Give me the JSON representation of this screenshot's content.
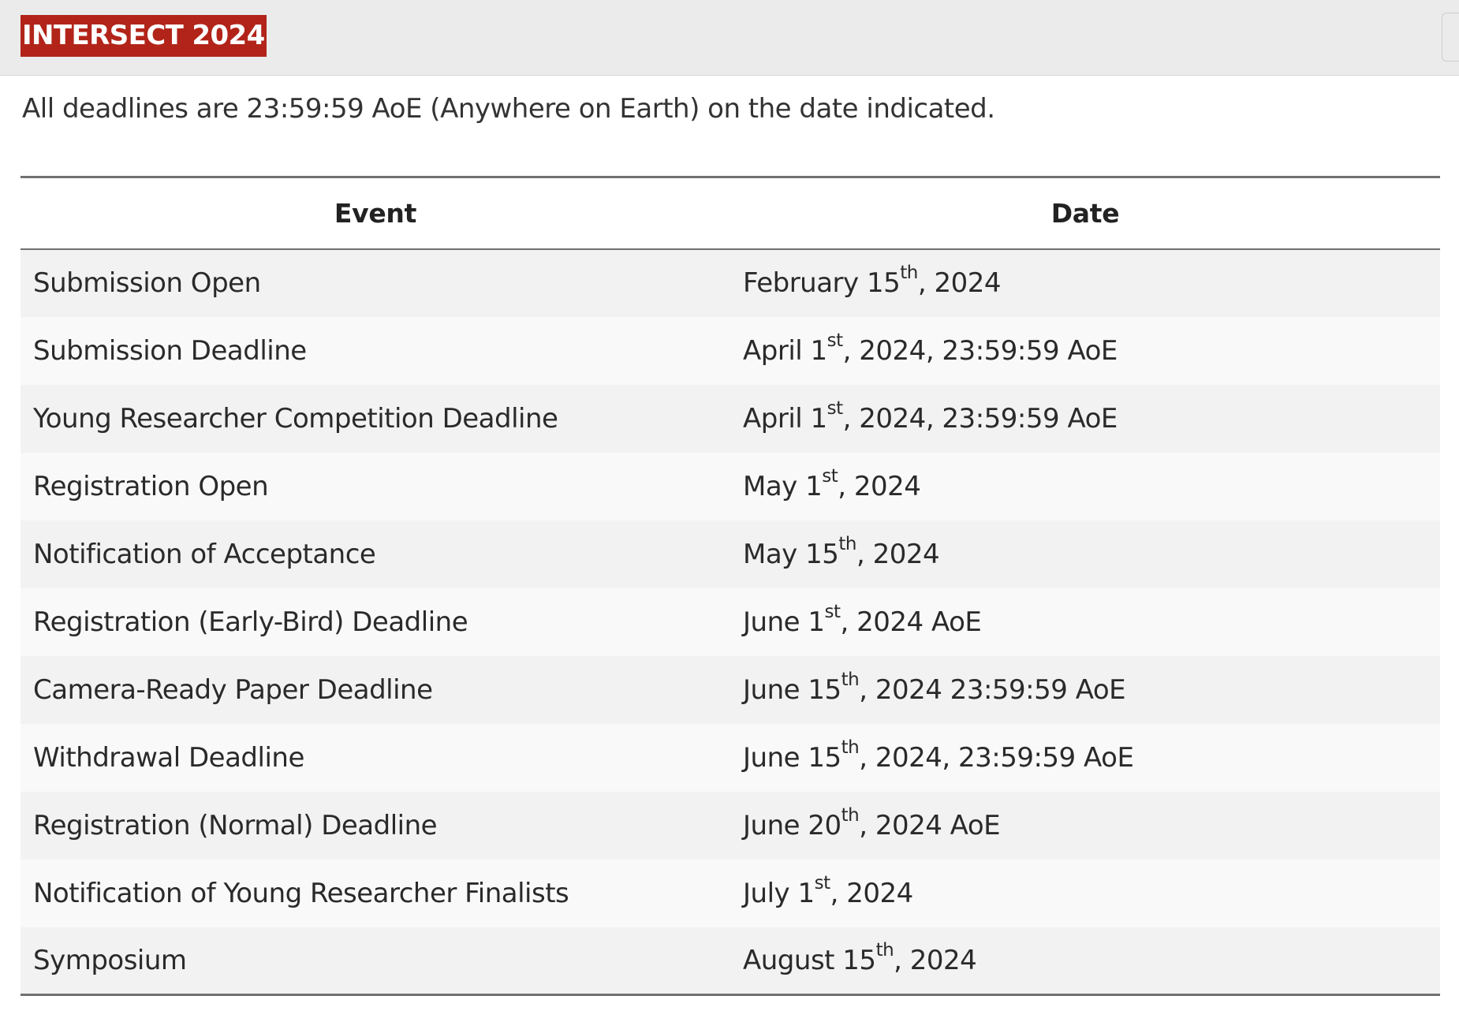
{
  "header": {
    "brand": "INTERSECT 2024"
  },
  "notice": "All deadlines are 23:59:59 AoE (Anywhere on Earth) on the date indicated.",
  "table": {
    "headers": [
      "Event",
      "Date"
    ],
    "rows": [
      {
        "event": "Submission Open",
        "date": {
          "pre": "February 15",
          "sup": "th",
          "post": ", 2024"
        }
      },
      {
        "event": "Submission Deadline",
        "date": {
          "pre": "April 1",
          "sup": "st",
          "post": ", 2024, 23:59:59 AoE"
        }
      },
      {
        "event": "Young Researcher Competition Deadline",
        "date": {
          "pre": "April 1",
          "sup": "st",
          "post": ", 2024, 23:59:59 AoE"
        }
      },
      {
        "event": "Registration Open",
        "date": {
          "pre": "May 1",
          "sup": "st",
          "post": ", 2024"
        }
      },
      {
        "event": "Notification of Acceptance",
        "date": {
          "pre": "May 15",
          "sup": "th",
          "post": ", 2024"
        }
      },
      {
        "event": "Registration (Early-Bird) Deadline",
        "date": {
          "pre": "June 1",
          "sup": "st",
          "post": ", 2024 AoE"
        }
      },
      {
        "event": "Camera-Ready Paper Deadline",
        "date": {
          "pre": "June 15",
          "sup": "th",
          "post": ", 2024 23:59:59 AoE"
        }
      },
      {
        "event": "Withdrawal Deadline",
        "date": {
          "pre": "June 15",
          "sup": "th",
          "post": ", 2024, 23:59:59 AoE"
        }
      },
      {
        "event": "Registration (Normal) Deadline",
        "date": {
          "pre": "June 20",
          "sup": "th",
          "post": ", 2024 AoE"
        }
      },
      {
        "event": "Notification of Young Researcher Finalists",
        "date": {
          "pre": "July 1",
          "sup": "st",
          "post": ", 2024"
        }
      },
      {
        "event": "Symposium",
        "date": {
          "pre": "August 15",
          "sup": "th",
          "post": ", 2024"
        }
      }
    ]
  },
  "colors": {
    "brand_bg": "#b22419",
    "brand_text": "#ffffff",
    "topbar_bg": "#ebebeb",
    "row_odd": "#f2f2f2",
    "row_even": "#f9f9f9",
    "rule": "#707070"
  },
  "icons": {
    "nav_toggle": "menu-toggle-icon"
  }
}
